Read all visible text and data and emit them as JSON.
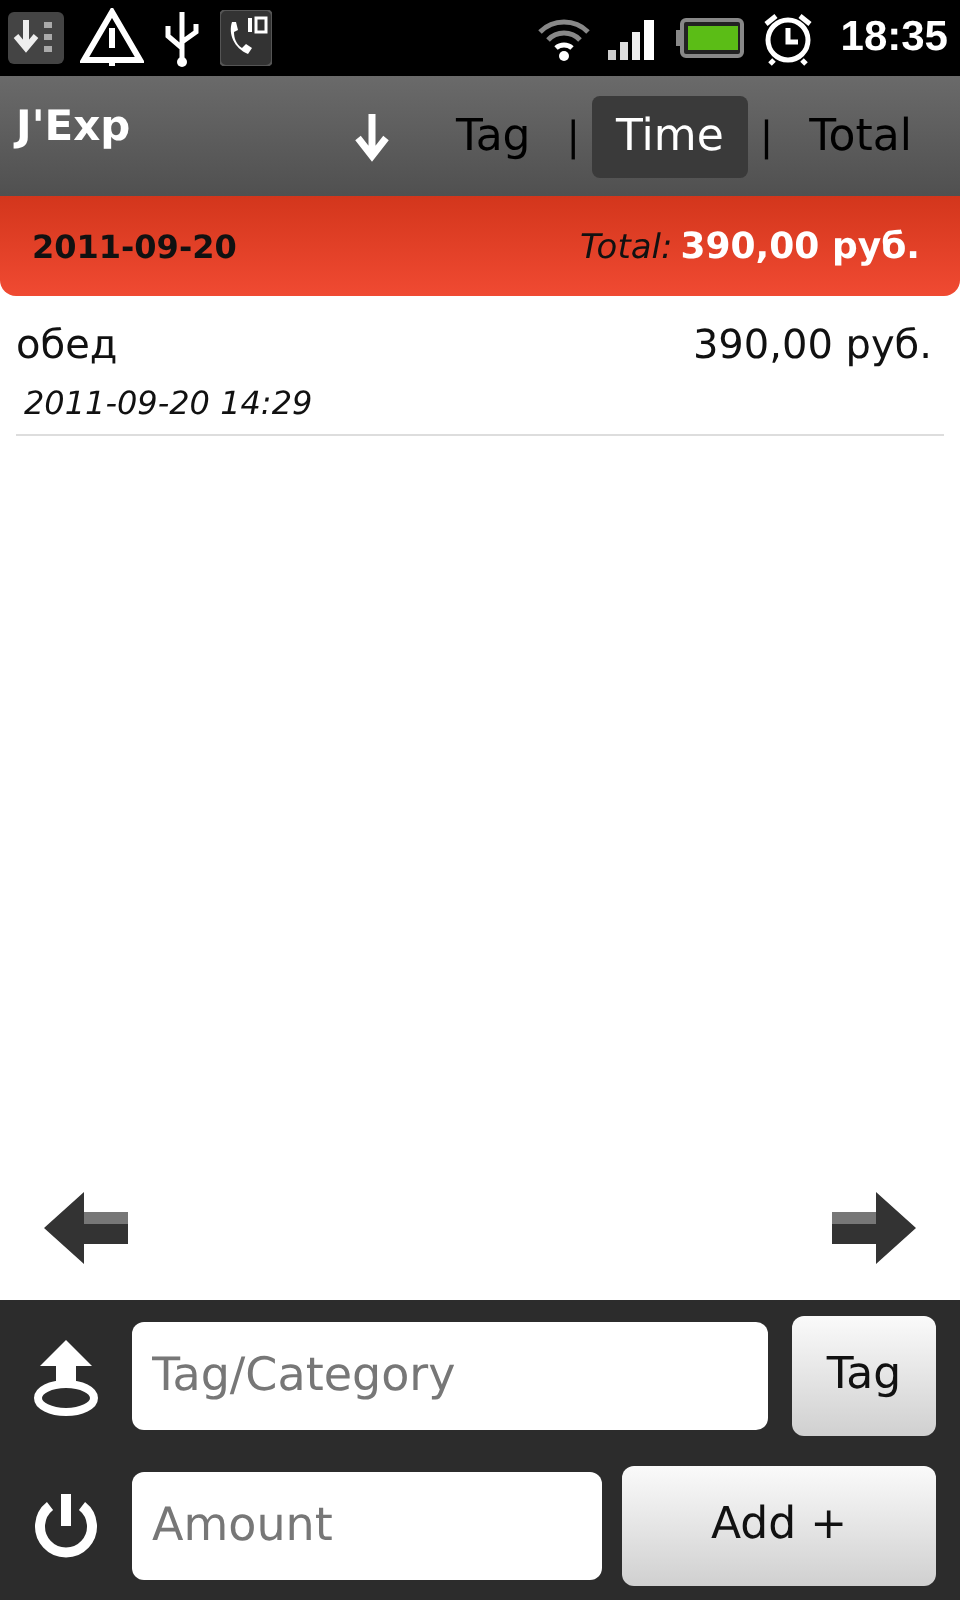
{
  "status_bar": {
    "time": "18:35"
  },
  "app_bar": {
    "title": "J'Exp",
    "tabs": [
      {
        "kind": "tab",
        "label": "Tag",
        "selected": false
      },
      {
        "kind": "separator",
        "label": "|"
      },
      {
        "kind": "tab",
        "label": "Time",
        "selected": true
      },
      {
        "kind": "separator",
        "label": "|"
      },
      {
        "kind": "tab",
        "label": "Total",
        "selected": false
      }
    ]
  },
  "group": {
    "date": "2011-09-20",
    "total_label": "Total:",
    "total": "390,00 руб."
  },
  "entries": [
    {
      "name": "обед",
      "amount": "390,00 руб.",
      "time": "2011-09-20 14:29"
    }
  ],
  "form": {
    "tag_field": {
      "placeholder": "Tag/Category"
    },
    "tag_button": "Tag",
    "amount_field": {
      "placeholder": "Amount"
    },
    "add_button": "Add +"
  }
}
